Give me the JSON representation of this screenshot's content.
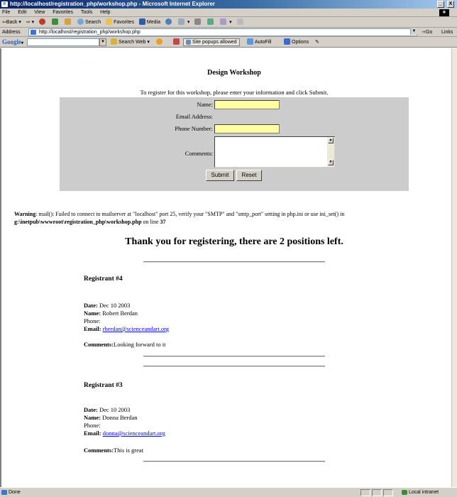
{
  "window": {
    "title": "http://localhost/registration_php/workshop.php - Microsoft Internet Explorer",
    "minimize": "_",
    "close": "X"
  },
  "menu": [
    "File",
    "Edit",
    "View",
    "Favorites",
    "Tools",
    "Help"
  ],
  "toolbar": {
    "back": "Back",
    "search": "Search",
    "favorites": "Favorites",
    "media": "Media"
  },
  "address": {
    "label": "Address",
    "url": "http://localhost/registration_php/workshop.php",
    "go": "Go",
    "links": "Links"
  },
  "google": {
    "logo": "Google",
    "search_web": "Search Web",
    "popups": "Site popups allowed",
    "autofill": "AutoFill",
    "options": "Options"
  },
  "page": {
    "title": "Design Workshop",
    "intro": "To register for this workshop, please enter your information and click Submit.",
    "form": {
      "name_label": "Name:",
      "email_label": "Email Address:",
      "phone_label": "Phone Number:",
      "comments_label": "Comments:",
      "submit": "Submit",
      "reset": "Reset"
    },
    "warning": {
      "label": "Warning",
      "text": ": mail(): Failed to connect to mailserver at \"localhost\" port 25, verify your \"SMTP\" and \"smtp_port\" setting in php.ini or use ini_set() in",
      "path": "g:\\inetpub\\wwwroot\\registration_php\\workshop.php",
      "on_line": " on line ",
      "line_no": "37"
    },
    "thanks": "Thank you for registering, there are 2 positions left.",
    "registrants": [
      {
        "heading": "Registrant #4",
        "date_label": "Date:",
        "date": " Dec 10 2003",
        "name_label": "Name:",
        "name": " Robert Berdan",
        "phone_label": "Phone:",
        "email_label": "Email:",
        "email": "rberdan@scienceandart.org",
        "comments_label": "Comments:",
        "comments": "Looking forward to it"
      },
      {
        "heading": "Registrant #3",
        "date_label": "Date:",
        "date": " Dec 10 2003",
        "name_label": "Name:",
        "name": " Donna Berdan",
        "phone_label": "Phone:",
        "email_label": "Email:",
        "email": "donna@scienceandart.org",
        "comments_label": "Comments:",
        "comments": "This is great"
      }
    ]
  },
  "status": {
    "text": "Done",
    "zone": "Local intranet"
  }
}
